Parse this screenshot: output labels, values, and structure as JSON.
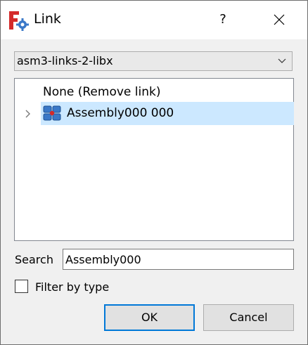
{
  "window": {
    "title": "Link",
    "help_glyph": "?",
    "app_icon": "freecad-gear-icon",
    "close_icon": "close-icon"
  },
  "document_combo": {
    "selected": "asm3-links-2-libx",
    "arrow_icon": "chevron-down-icon"
  },
  "tree": {
    "items": [
      {
        "label": "None (Remove link)",
        "selected": false
      },
      {
        "label": "Assembly000 000",
        "selected": true,
        "icon": "assembly-icon",
        "expander_icon": "chevron-right-icon"
      }
    ],
    "selection_color": "#cce8ff"
  },
  "search": {
    "label": "Search",
    "value": "Assembly000"
  },
  "filter": {
    "label": "Filter by type",
    "checked": false
  },
  "buttons": {
    "ok": "OK",
    "cancel": "Cancel"
  },
  "colors": {
    "accent": "#0078d7",
    "app_red": "#d42a2a",
    "icon_blue": "#3a78c8"
  }
}
